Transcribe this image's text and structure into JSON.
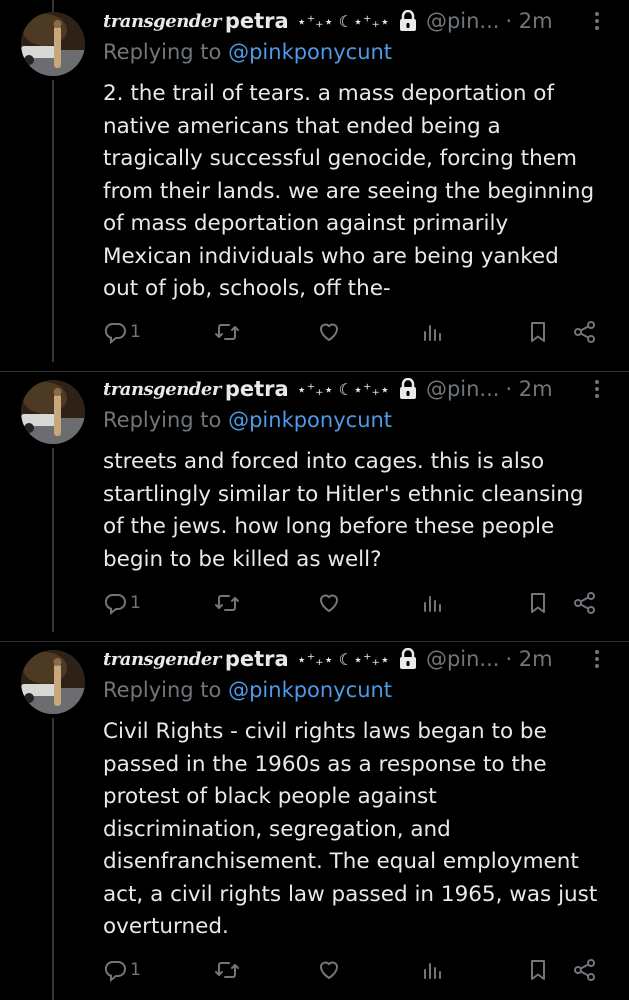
{
  "tweets": [
    {
      "fancy_name": "transgender",
      "name": "petra",
      "sparkles": "⋆⁺₊⋆ ☾⋆⁺₊⋆",
      "handle": "@pin...",
      "time": "· 2m",
      "reply_prefix": "Replying to",
      "reply_to": "@pinkponycunt",
      "lines": [
        "2. the trail of tears. a mass deportation of",
        "native americans that ended being a",
        "tragically successful genocide, forcing them",
        "from their lands. we are seeing the beginning",
        "of mass deportation against primarily",
        "Mexican individuals who are being yanked",
        "out of job, schools, off the-"
      ],
      "reply_count": "1"
    },
    {
      "fancy_name": "transgender",
      "name": "petra",
      "sparkles": "⋆⁺₊⋆ ☾⋆⁺₊⋆",
      "handle": "@pin...",
      "time": "· 2m",
      "reply_prefix": "Replying to",
      "reply_to": "@pinkponycunt",
      "lines": [
        "streets and forced into cages. this is also",
        "startlingly similar to Hitler's ethnic cleansing",
        "of the jews. how long before these people",
        "begin to be killed as well?"
      ],
      "reply_count": "1"
    },
    {
      "fancy_name": "transgender",
      "name": "petra",
      "sparkles": "⋆⁺₊⋆ ☾⋆⁺₊⋆",
      "handle": "@pin...",
      "time": "· 2m",
      "reply_prefix": "Replying to",
      "reply_to": "@pinkponycunt",
      "lines": [
        "Civil Rights - civil rights laws began to be",
        "passed in the 1960s as a response to the",
        "protest of black people against",
        "discrimination, segregation, and",
        "disenfranchisement. The equal employment",
        "act, a civil rights law passed in 1965, was just",
        "overturned."
      ],
      "reply_count": "1"
    }
  ],
  "icons": {
    "reply": "reply-icon",
    "retweet": "retweet-icon",
    "like": "heart-icon",
    "views": "views-icon",
    "bookmark": "bookmark-icon",
    "share": "share-icon",
    "lock": "lock-icon",
    "more": "more-icon"
  },
  "colors": {
    "background": "#000000",
    "text": "#e7e9ea",
    "muted": "#71767b",
    "link": "#4c9ae8",
    "divider": "#2f3336"
  }
}
